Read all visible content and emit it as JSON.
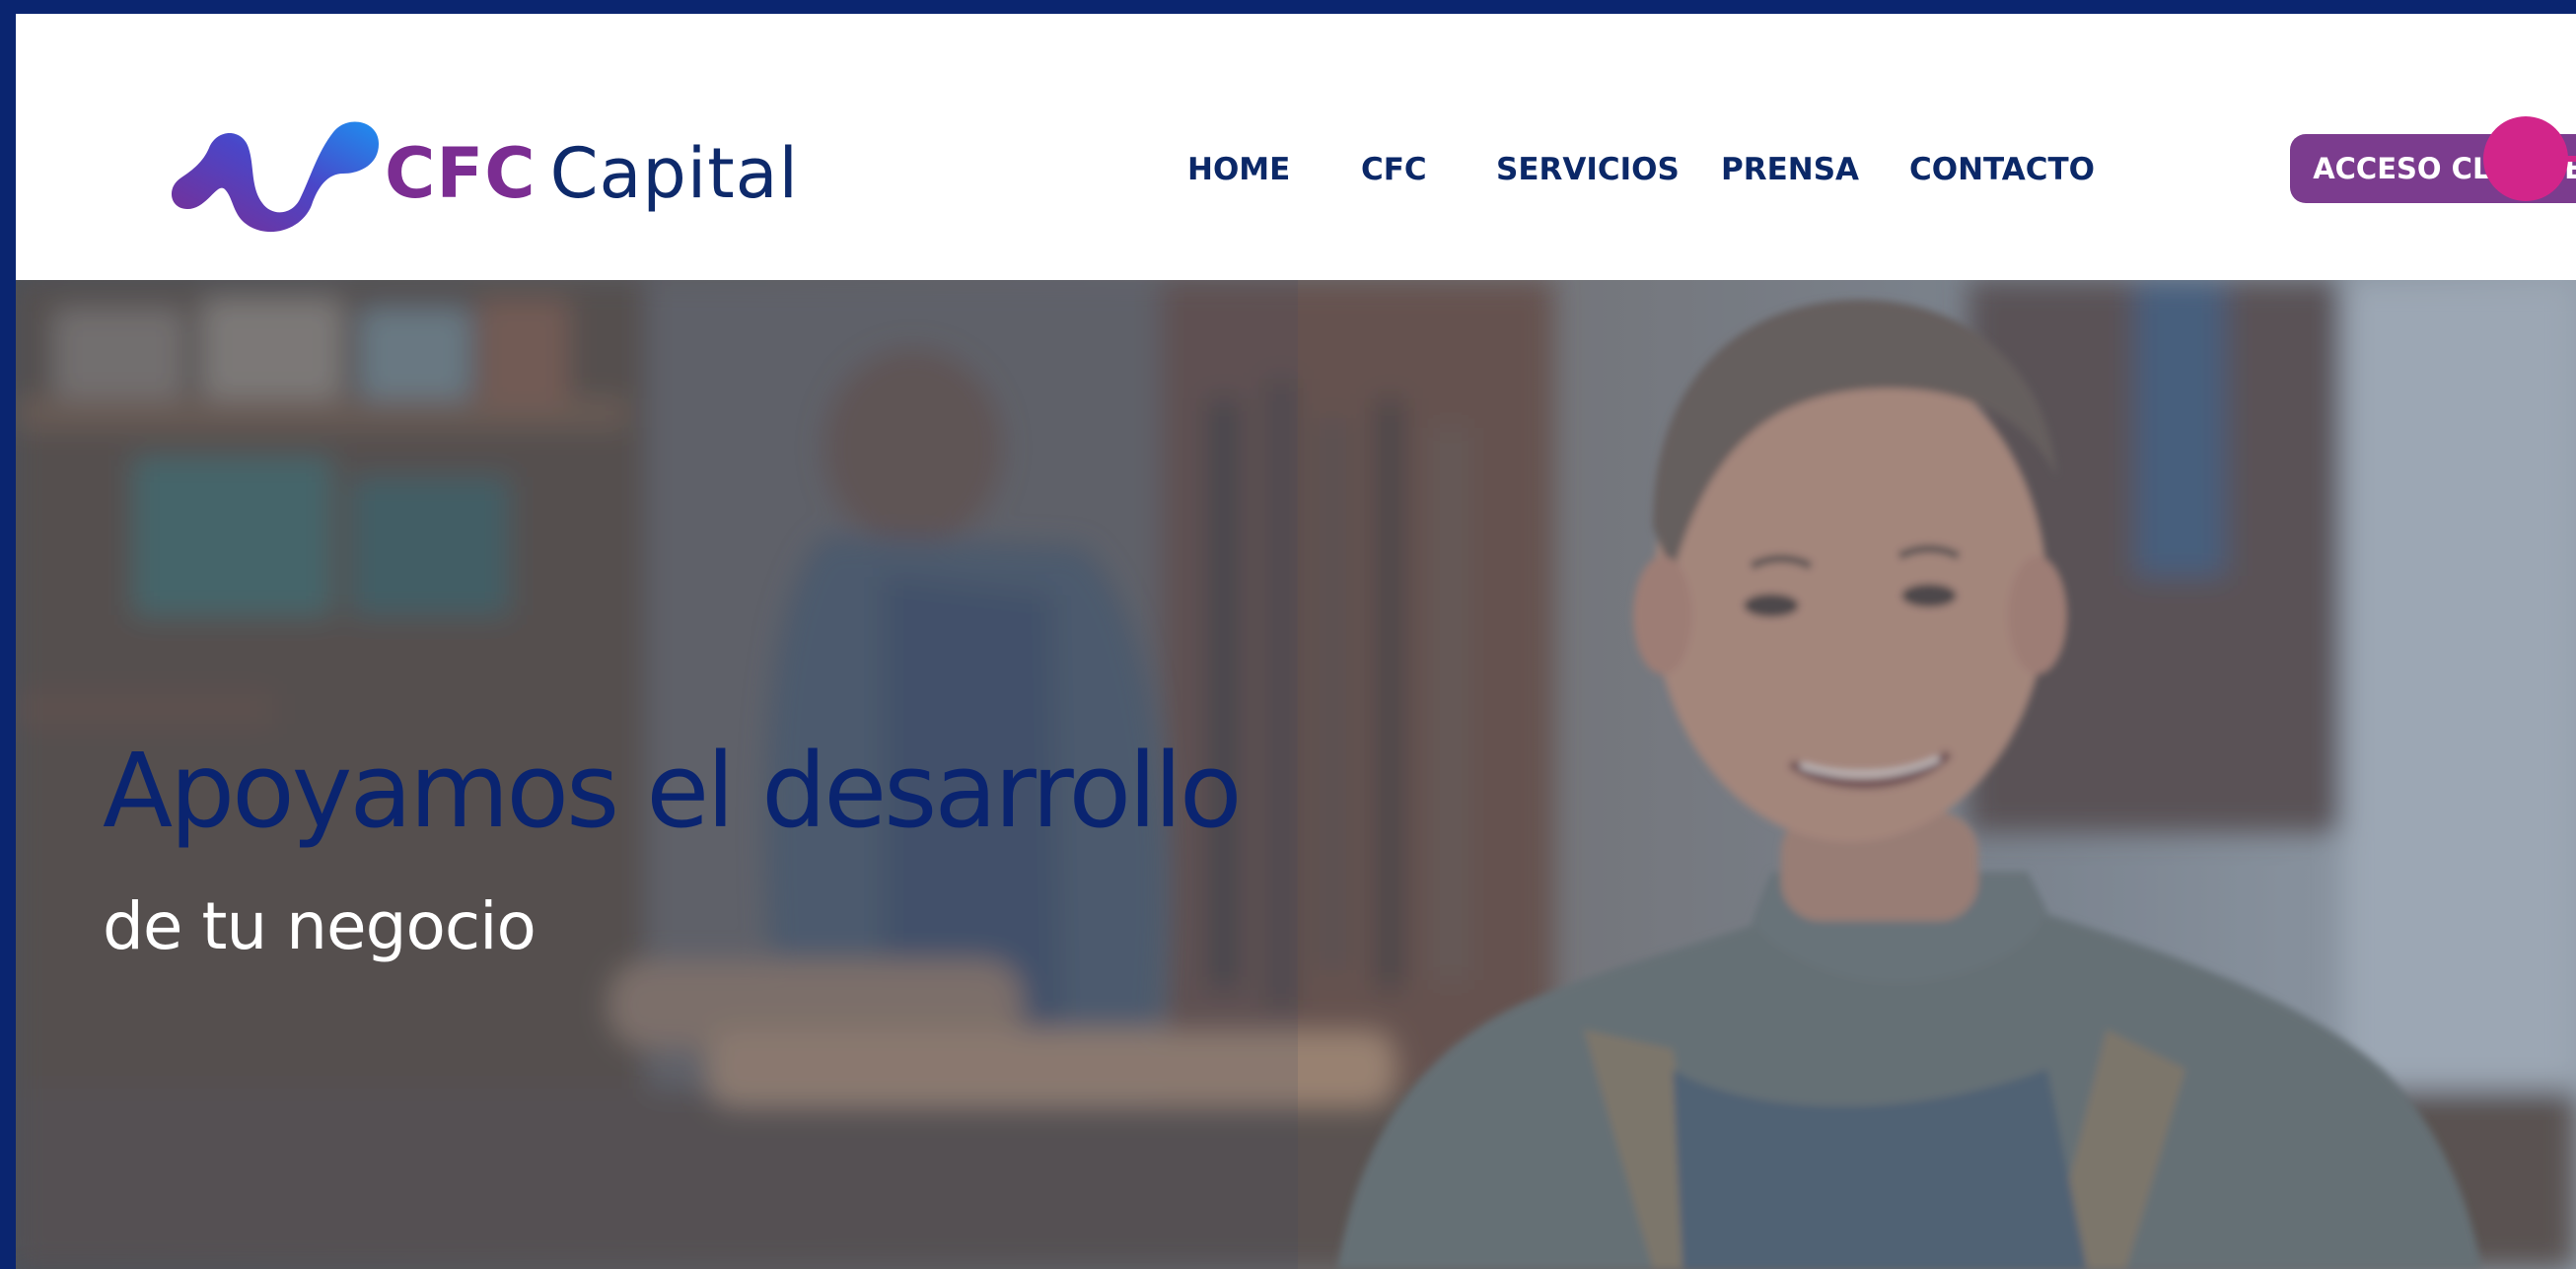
{
  "brand": {
    "name_bold": "CFC",
    "name_rest": "Capital",
    "logo_icon": "cfc-wave-logo-icon",
    "colors": {
      "purple": "#7b2d92",
      "navy": "#0e2a6b",
      "blue": "#1e6fd9",
      "pink": "#d2258a"
    }
  },
  "nav": {
    "items": [
      {
        "label": "HOME"
      },
      {
        "label": "CFC"
      },
      {
        "label": "SERVICIOS"
      },
      {
        "label": "PRENSA"
      },
      {
        "label": "CONTACTO"
      }
    ],
    "cta_label": "ACCESO CLIENTES",
    "cta_color": "#7b3c8e",
    "toggle_icon": "pink-dot-toggle-icon"
  },
  "hero": {
    "title": "Apoyamos el desarrollo",
    "subtitle": "de tu negocio",
    "image": "workshop-craftsmen-photo"
  }
}
